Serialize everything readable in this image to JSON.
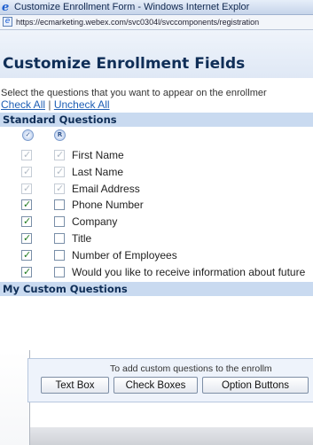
{
  "window": {
    "title": "Customize Enrollment Form - Windows Internet Explor",
    "address": "https://ecmarketing.webex.com/svc0304l/svccomponents/registration"
  },
  "page": {
    "title": "Customize Enrollment Fields",
    "instructions": "Select the questions that you want to appear on the enrollmer",
    "check_all": "Check All",
    "separator": "|",
    "uncheck_all": "Uncheck All"
  },
  "standard": {
    "header": "Standard Questions",
    "col1_icon": "check-icon",
    "col2_icon": "required-icon",
    "col2_glyph": "R",
    "rows": [
      {
        "label": "First Name",
        "display": true,
        "required": true,
        "locked": true
      },
      {
        "label": "Last Name",
        "display": true,
        "required": true,
        "locked": true
      },
      {
        "label": "Email Address",
        "display": true,
        "required": true,
        "locked": true
      },
      {
        "label": "Phone Number",
        "display": true,
        "required": false,
        "locked": false
      },
      {
        "label": "Company",
        "display": true,
        "required": false,
        "locked": false
      },
      {
        "label": "Title",
        "display": true,
        "required": false,
        "locked": false
      },
      {
        "label": "Number of Employees",
        "display": true,
        "required": false,
        "locked": false
      },
      {
        "label": "Would you like to receive information about future",
        "display": true,
        "required": false,
        "locked": false
      }
    ]
  },
  "custom": {
    "header": "My Custom Questions",
    "add_text": "To add custom questions to the enrollm",
    "buttons": {
      "text_box": "Text Box",
      "check_boxes": "Check Boxes",
      "option_buttons": "Option Buttons"
    }
  },
  "colors": {
    "accent": "#1f5fb5",
    "section_header": "#c9daf0",
    "title": "#0f2e57",
    "check": "#1f7a1f"
  }
}
